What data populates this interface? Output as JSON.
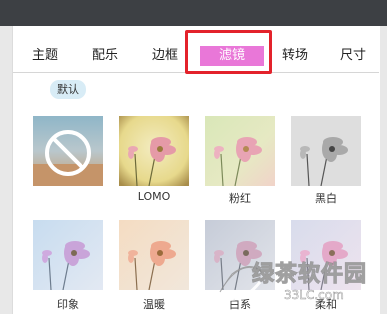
{
  "tabs": [
    {
      "label": "主题"
    },
    {
      "label": "配乐"
    },
    {
      "label": "边框"
    },
    {
      "label": "滤镜",
      "active": true
    },
    {
      "label": "转场"
    },
    {
      "label": "尺寸"
    }
  ],
  "default_badge": "默认",
  "filters": [
    {
      "caption": "",
      "kind": "none"
    },
    {
      "caption": "LOMO",
      "kind": "lomo"
    },
    {
      "caption": "粉红",
      "kind": "pink"
    },
    {
      "caption": "黑白",
      "kind": "bw"
    },
    {
      "caption": "印象",
      "kind": "impression"
    },
    {
      "caption": "温暖",
      "kind": "warm"
    },
    {
      "caption": "白系",
      "kind": "white"
    },
    {
      "caption": "柔和",
      "kind": "soft"
    }
  ],
  "watermark": {
    "title": "绿茶软件园",
    "sub": "33LC.com"
  },
  "colors": {
    "active_tab": "#e977d8",
    "highlight": "#e3222b",
    "badge": "#d8ecf6"
  }
}
